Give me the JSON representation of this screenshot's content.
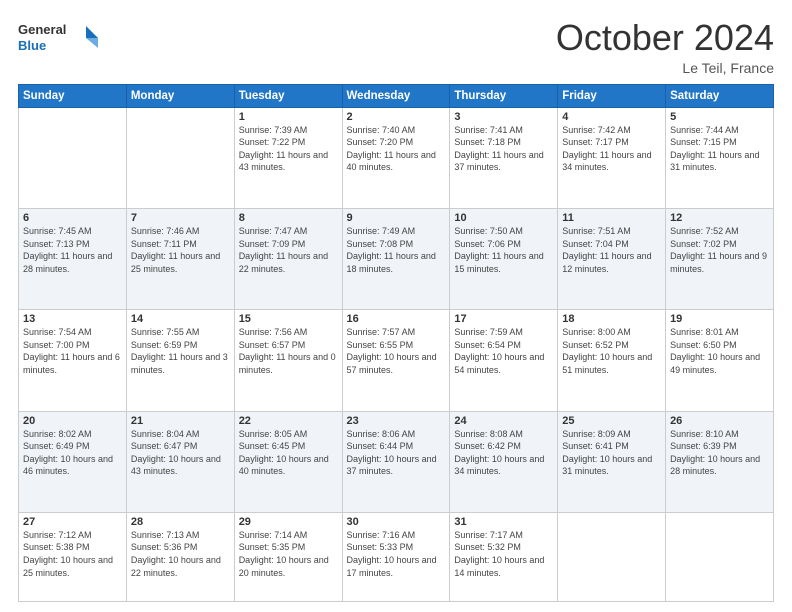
{
  "header": {
    "logo_line1": "General",
    "logo_line2": "Blue",
    "month_title": "October 2024",
    "location": "Le Teil, France"
  },
  "weekdays": [
    "Sunday",
    "Monday",
    "Tuesday",
    "Wednesday",
    "Thursday",
    "Friday",
    "Saturday"
  ],
  "weeks": [
    [
      {
        "day": "",
        "info": ""
      },
      {
        "day": "",
        "info": ""
      },
      {
        "day": "1",
        "info": "Sunrise: 7:39 AM\nSunset: 7:22 PM\nDaylight: 11 hours and 43 minutes."
      },
      {
        "day": "2",
        "info": "Sunrise: 7:40 AM\nSunset: 7:20 PM\nDaylight: 11 hours and 40 minutes."
      },
      {
        "day": "3",
        "info": "Sunrise: 7:41 AM\nSunset: 7:18 PM\nDaylight: 11 hours and 37 minutes."
      },
      {
        "day": "4",
        "info": "Sunrise: 7:42 AM\nSunset: 7:17 PM\nDaylight: 11 hours and 34 minutes."
      },
      {
        "day": "5",
        "info": "Sunrise: 7:44 AM\nSunset: 7:15 PM\nDaylight: 11 hours and 31 minutes."
      }
    ],
    [
      {
        "day": "6",
        "info": "Sunrise: 7:45 AM\nSunset: 7:13 PM\nDaylight: 11 hours and 28 minutes."
      },
      {
        "day": "7",
        "info": "Sunrise: 7:46 AM\nSunset: 7:11 PM\nDaylight: 11 hours and 25 minutes."
      },
      {
        "day": "8",
        "info": "Sunrise: 7:47 AM\nSunset: 7:09 PM\nDaylight: 11 hours and 22 minutes."
      },
      {
        "day": "9",
        "info": "Sunrise: 7:49 AM\nSunset: 7:08 PM\nDaylight: 11 hours and 18 minutes."
      },
      {
        "day": "10",
        "info": "Sunrise: 7:50 AM\nSunset: 7:06 PM\nDaylight: 11 hours and 15 minutes."
      },
      {
        "day": "11",
        "info": "Sunrise: 7:51 AM\nSunset: 7:04 PM\nDaylight: 11 hours and 12 minutes."
      },
      {
        "day": "12",
        "info": "Sunrise: 7:52 AM\nSunset: 7:02 PM\nDaylight: 11 hours and 9 minutes."
      }
    ],
    [
      {
        "day": "13",
        "info": "Sunrise: 7:54 AM\nSunset: 7:00 PM\nDaylight: 11 hours and 6 minutes."
      },
      {
        "day": "14",
        "info": "Sunrise: 7:55 AM\nSunset: 6:59 PM\nDaylight: 11 hours and 3 minutes."
      },
      {
        "day": "15",
        "info": "Sunrise: 7:56 AM\nSunset: 6:57 PM\nDaylight: 11 hours and 0 minutes."
      },
      {
        "day": "16",
        "info": "Sunrise: 7:57 AM\nSunset: 6:55 PM\nDaylight: 10 hours and 57 minutes."
      },
      {
        "day": "17",
        "info": "Sunrise: 7:59 AM\nSunset: 6:54 PM\nDaylight: 10 hours and 54 minutes."
      },
      {
        "day": "18",
        "info": "Sunrise: 8:00 AM\nSunset: 6:52 PM\nDaylight: 10 hours and 51 minutes."
      },
      {
        "day": "19",
        "info": "Sunrise: 8:01 AM\nSunset: 6:50 PM\nDaylight: 10 hours and 49 minutes."
      }
    ],
    [
      {
        "day": "20",
        "info": "Sunrise: 8:02 AM\nSunset: 6:49 PM\nDaylight: 10 hours and 46 minutes."
      },
      {
        "day": "21",
        "info": "Sunrise: 8:04 AM\nSunset: 6:47 PM\nDaylight: 10 hours and 43 minutes."
      },
      {
        "day": "22",
        "info": "Sunrise: 8:05 AM\nSunset: 6:45 PM\nDaylight: 10 hours and 40 minutes."
      },
      {
        "day": "23",
        "info": "Sunrise: 8:06 AM\nSunset: 6:44 PM\nDaylight: 10 hours and 37 minutes."
      },
      {
        "day": "24",
        "info": "Sunrise: 8:08 AM\nSunset: 6:42 PM\nDaylight: 10 hours and 34 minutes."
      },
      {
        "day": "25",
        "info": "Sunrise: 8:09 AM\nSunset: 6:41 PM\nDaylight: 10 hours and 31 minutes."
      },
      {
        "day": "26",
        "info": "Sunrise: 8:10 AM\nSunset: 6:39 PM\nDaylight: 10 hours and 28 minutes."
      }
    ],
    [
      {
        "day": "27",
        "info": "Sunrise: 7:12 AM\nSunset: 5:38 PM\nDaylight: 10 hours and 25 minutes."
      },
      {
        "day": "28",
        "info": "Sunrise: 7:13 AM\nSunset: 5:36 PM\nDaylight: 10 hours and 22 minutes."
      },
      {
        "day": "29",
        "info": "Sunrise: 7:14 AM\nSunset: 5:35 PM\nDaylight: 10 hours and 20 minutes."
      },
      {
        "day": "30",
        "info": "Sunrise: 7:16 AM\nSunset: 5:33 PM\nDaylight: 10 hours and 17 minutes."
      },
      {
        "day": "31",
        "info": "Sunrise: 7:17 AM\nSunset: 5:32 PM\nDaylight: 10 hours and 14 minutes."
      },
      {
        "day": "",
        "info": ""
      },
      {
        "day": "",
        "info": ""
      }
    ]
  ]
}
